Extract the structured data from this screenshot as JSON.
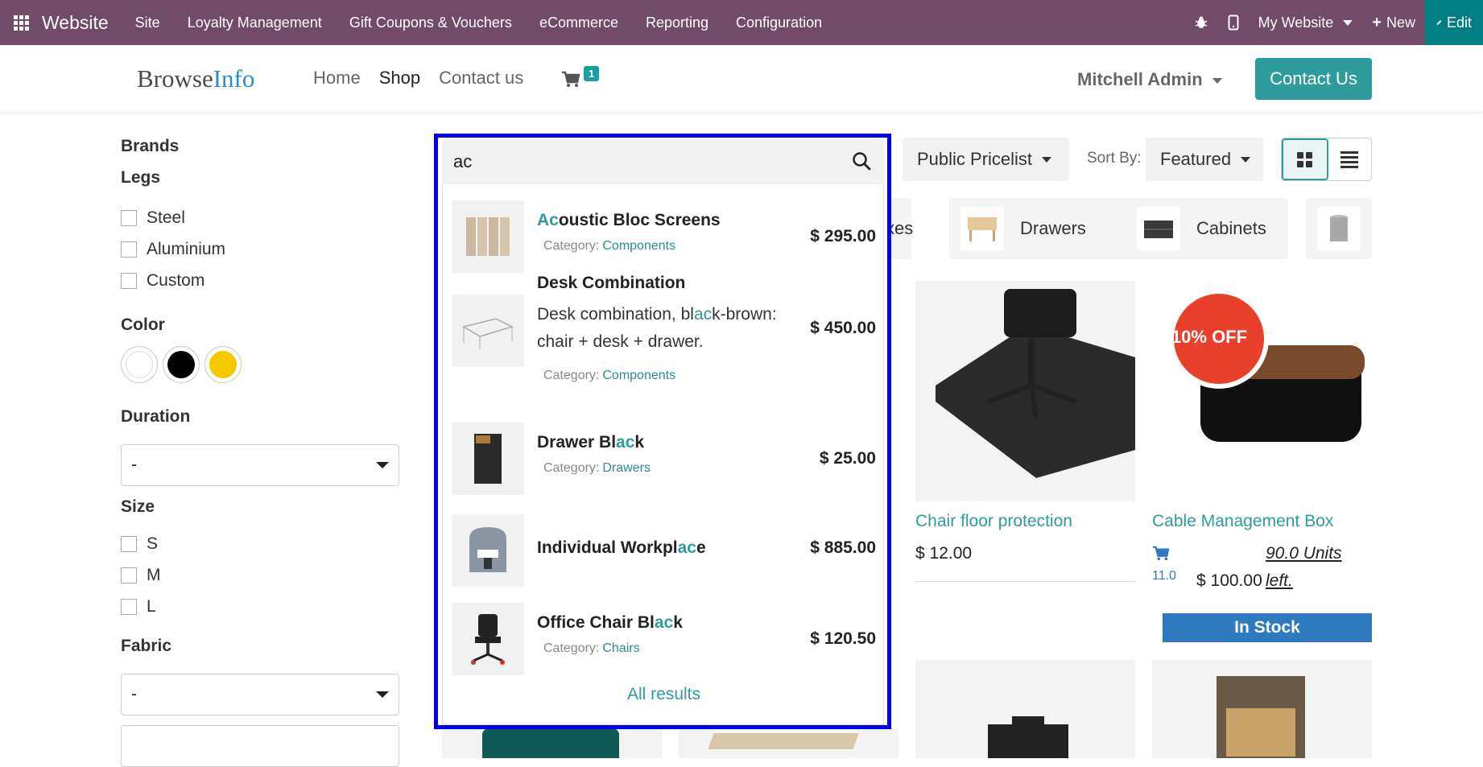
{
  "topbar": {
    "app_name": "Website",
    "menu": [
      "Site",
      "Loyalty Management",
      "Gift Coupons & Vouchers",
      "eCommerce",
      "Reporting",
      "Configuration"
    ],
    "website_selector": "My Website",
    "new_label": "New",
    "edit_label": "Edit"
  },
  "header": {
    "logo_part1": "Browse",
    "logo_part2": "Info",
    "nav": [
      "Home",
      "Shop",
      "Contact us"
    ],
    "cart_count": "1",
    "user": "Mitchell Admin",
    "contact_button": "Contact Us"
  },
  "sidebar": {
    "brands": "Brands",
    "legs_title": "Legs",
    "legs": [
      "Steel",
      "Aluminium",
      "Custom"
    ],
    "color_title": "Color",
    "colors": [
      "#ffffff",
      "#000000",
      "#f5c800"
    ],
    "duration_title": "Duration",
    "duration_value": "-",
    "size_title": "Size",
    "sizes": [
      "S",
      "M",
      "L"
    ],
    "fabric_title": "Fabric",
    "fabric_value": "-"
  },
  "toolbar": {
    "pricelist": "Public Pricelist",
    "sort_label": "Sort By:",
    "sort_value": "Featured"
  },
  "categories": {
    "partial": "xes",
    "drawers": "Drawers",
    "cabinets": "Cabinets"
  },
  "products": {
    "p1_title": "Chair floor protection",
    "p1_price": "$ 12.00",
    "p2_title": "Cable Management Box",
    "p2_badge": "10% OFF",
    "p2_cart_qty": "11.0",
    "p2_price": "$ 100.00",
    "p2_units": "90.0 Units",
    "p2_left": "left.",
    "p2_stock": "In Stock"
  },
  "search": {
    "query": "ac",
    "results": [
      {
        "name_pre": "",
        "name_hl": "Ac",
        "name_post": "oustic Bloc Screens",
        "category_label": "Category:",
        "category": "Components",
        "price": "$ 295.00"
      },
      {
        "name": "Desk Combination",
        "desc_pre": "Desk combination, bl",
        "desc_hl": "ac",
        "desc_post": "k-brown: chair + desk + drawer.",
        "category_label": "Category:",
        "category": "Components",
        "price": "$ 450.00"
      },
      {
        "name_pre": "Drawer Bl",
        "name_hl": "ac",
        "name_post": "k",
        "category_label": "Category:",
        "category": "Drawers",
        "price": "$ 25.00"
      },
      {
        "name_pre": "Individual Workpl",
        "name_hl": "ac",
        "name_post": "e",
        "price": "$ 885.00"
      },
      {
        "name_pre": "Office Chair Bl",
        "name_hl": "ac",
        "name_post": "k",
        "category_label": "Category:",
        "category": "Chairs",
        "price": "$ 120.50"
      }
    ],
    "all_results": "All results"
  }
}
